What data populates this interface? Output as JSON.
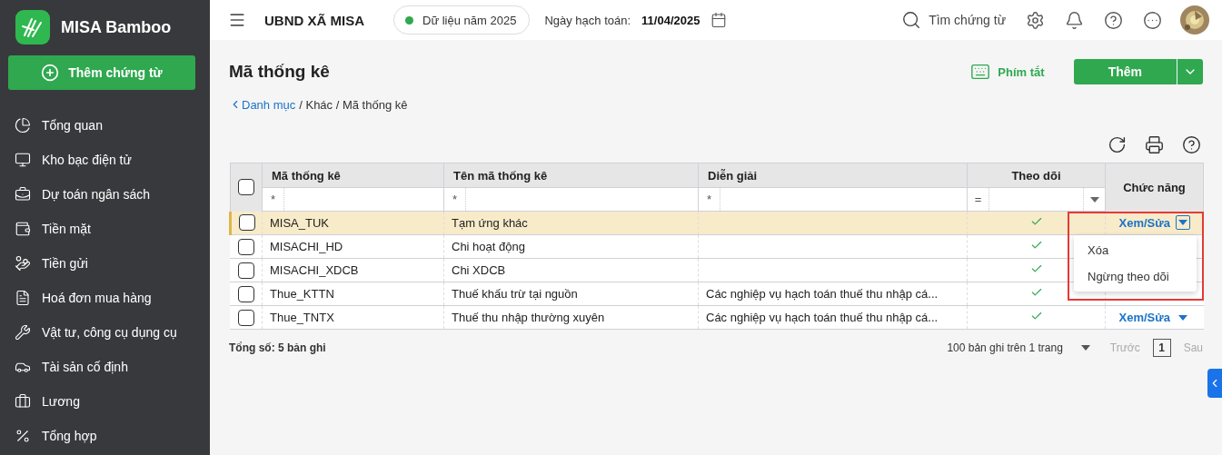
{
  "sidebar": {
    "brand": "MISA Bamboo",
    "add_button": "Thêm chứng từ",
    "items": [
      {
        "label": "Tổng quan",
        "selected": false
      },
      {
        "label": "Kho bạc điện tử",
        "selected": false
      },
      {
        "label": "Dự toán ngân sách",
        "selected": false
      },
      {
        "label": "Tiền mặt",
        "selected": false
      },
      {
        "label": "Tiền gửi",
        "selected": false
      },
      {
        "label": "Hoá đơn mua hàng",
        "selected": false
      },
      {
        "label": "Vật tư, công cụ dụng cụ",
        "selected": false
      },
      {
        "label": "Tài sản cố định",
        "selected": false
      },
      {
        "label": "Lương",
        "selected": false
      },
      {
        "label": "Tổng hợp",
        "selected": false
      }
    ]
  },
  "topbar": {
    "organization": "UBND XÃ MISA",
    "data_year": "Dữ liệu năm 2025",
    "date_label": "Ngày hạch toán:",
    "date": "11/04/2025",
    "search": "Tìm chứng từ"
  },
  "page": {
    "title": "Mã thống kê",
    "breadcrumb": {
      "link": "Danh mục",
      "trail": "/ Khác / Mã thống kê"
    },
    "shortcut": "Phím tắt",
    "add": "Thêm"
  },
  "table": {
    "columns": [
      "Mã thống kê",
      "Tên mã thống kê",
      "Diễn giải",
      "Theo dõi",
      "Chức năng"
    ],
    "select_all_checked": false,
    "filters": [
      "*",
      "*",
      "*",
      "="
    ],
    "rows": [
      {
        "code": "MISA_TUK",
        "name": "Tạm ứng khác",
        "description": "",
        "tracked": true,
        "action": "Xem/Sửa",
        "checked": false,
        "selected": true
      },
      {
        "code": "MISACHI_HD",
        "name": "Chi hoạt động",
        "description": "",
        "tracked": true,
        "checked": false,
        "selected": false
      },
      {
        "code": "MISACHI_XDCB",
        "name": "Chi XDCB",
        "description": "",
        "tracked": true,
        "checked": false,
        "selected": false
      },
      {
        "code": "Thue_KTTN",
        "name": "Thuế khấu trừ tại nguồn",
        "description": "Các nghiệp vụ hạch toán thuế thu nhập cá...",
        "tracked": true,
        "checked": false,
        "selected": false
      },
      {
        "code": "Thue_TNTX",
        "name": "Thuế thu nhập thường xuyên",
        "description": "Các nghiệp vụ hạch toán thuế thu nhập cá...",
        "tracked": true,
        "action": "Xem/Sửa",
        "checked": false,
        "selected": false
      }
    ],
    "action_menu": {
      "open": true,
      "items": [
        "Xóa",
        "Ngừng theo dõi"
      ]
    },
    "total": "Tổng số: 5 bản ghi",
    "page_size": "100 bản ghi trên 1 trang",
    "prev": "Trước",
    "page": "1",
    "next": "Sau"
  }
}
